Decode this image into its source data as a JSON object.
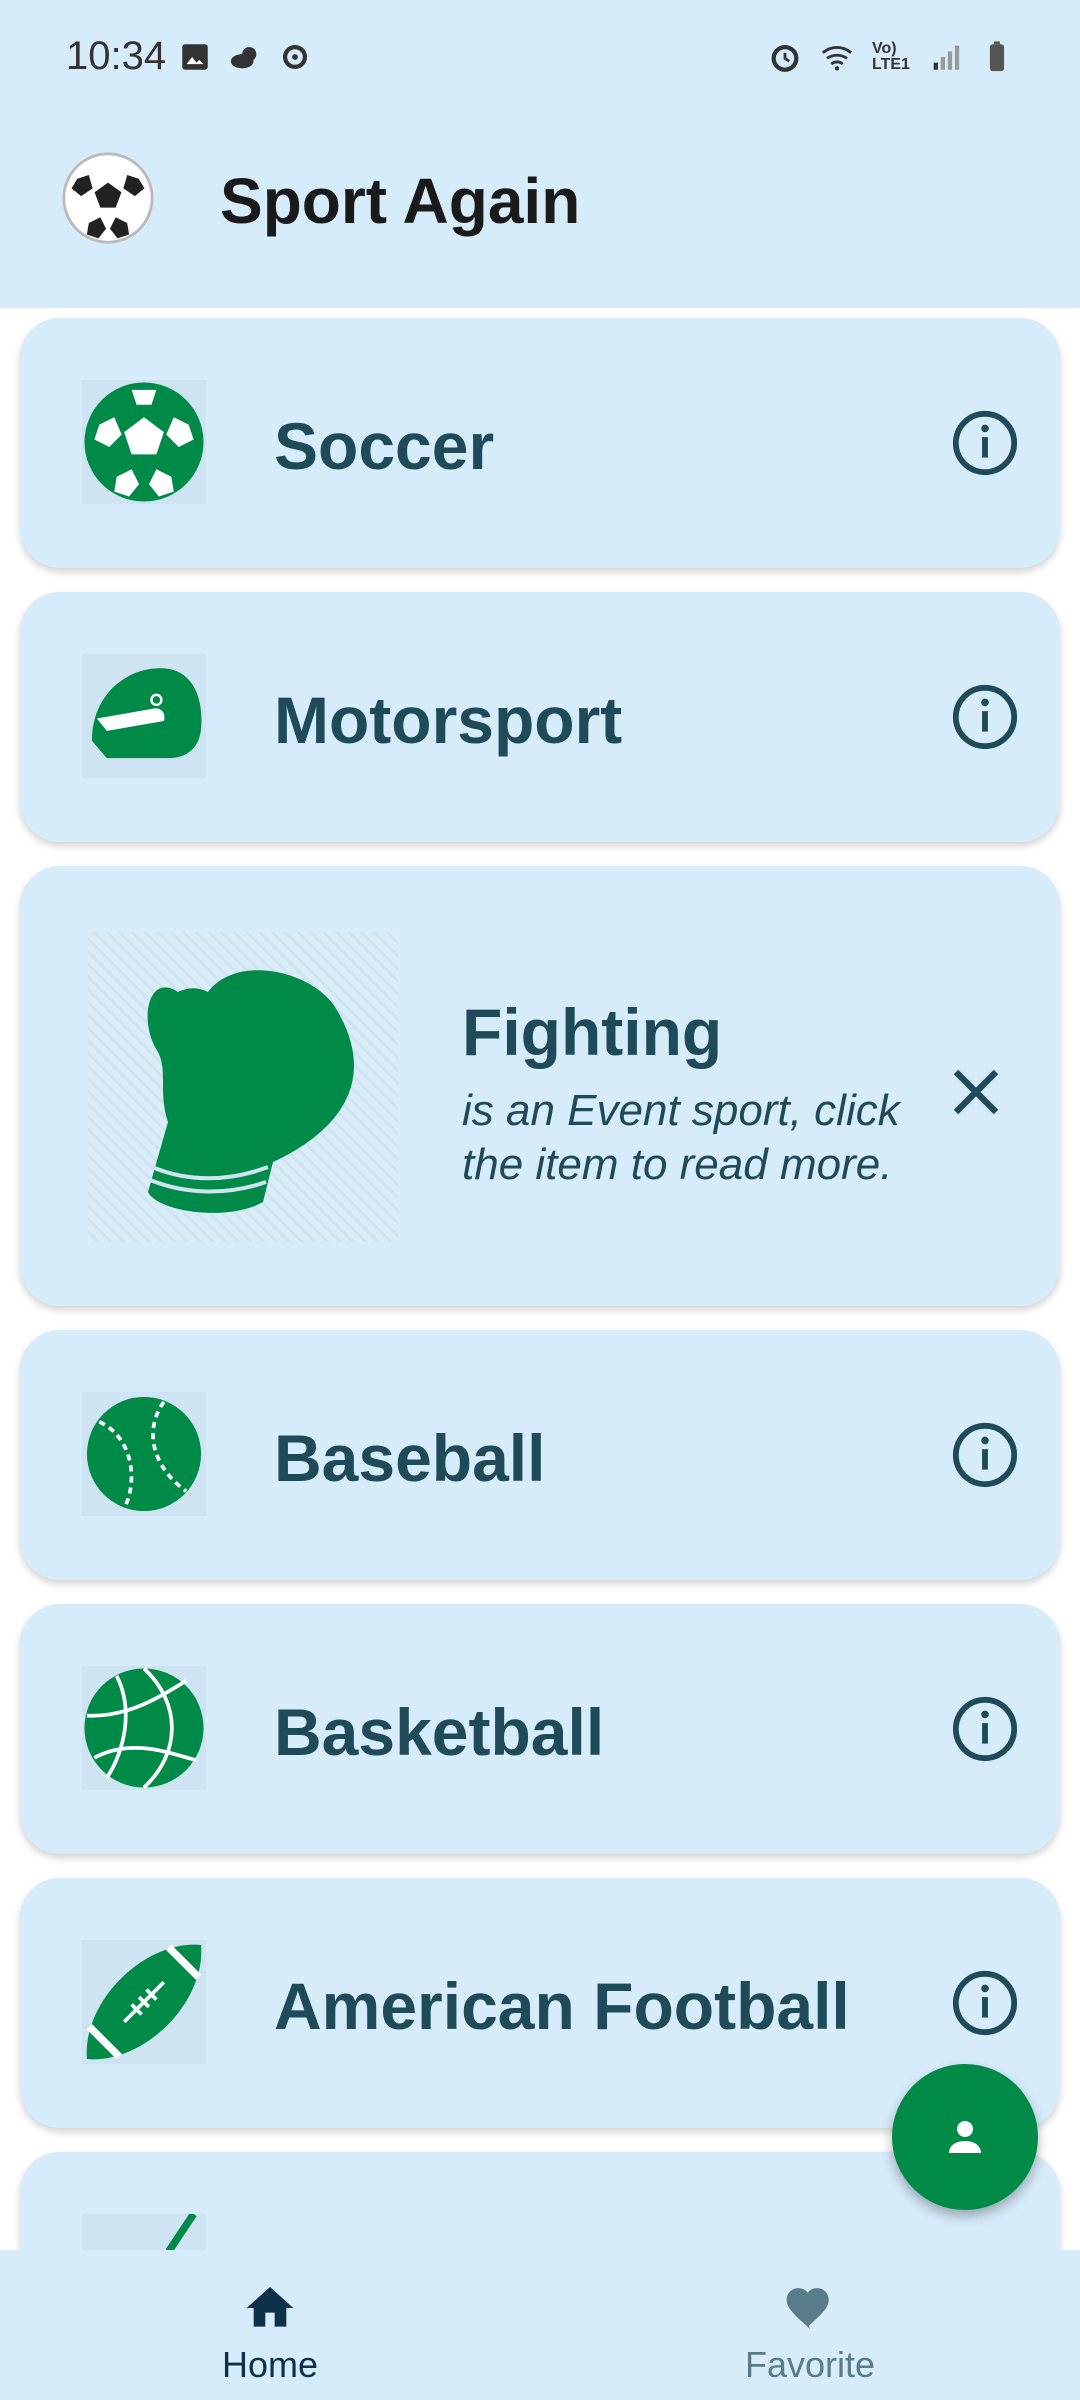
{
  "status_bar": {
    "time": "10:34",
    "network_label": "Vo) LTE1"
  },
  "app": {
    "title": "Sport Again"
  },
  "sports": [
    {
      "name": "Soccer",
      "icon": "soccer-ball-icon"
    },
    {
      "name": "Motorsport",
      "icon": "helmet-icon"
    },
    {
      "name": "Fighting",
      "icon": "boxing-glove-icon",
      "description": "is an Event sport, click the item to read more.",
      "expanded": true
    },
    {
      "name": "Baseball",
      "icon": "baseball-icon"
    },
    {
      "name": "Basketball",
      "icon": "basketball-icon"
    },
    {
      "name": "American Football",
      "icon": "american-football-icon"
    }
  ],
  "bottom_nav": {
    "home_label": "Home",
    "favorite_label": "Favorite"
  },
  "colors": {
    "accent": "#008a47",
    "card": "#d6ecfb",
    "text": "#1f4a57"
  }
}
